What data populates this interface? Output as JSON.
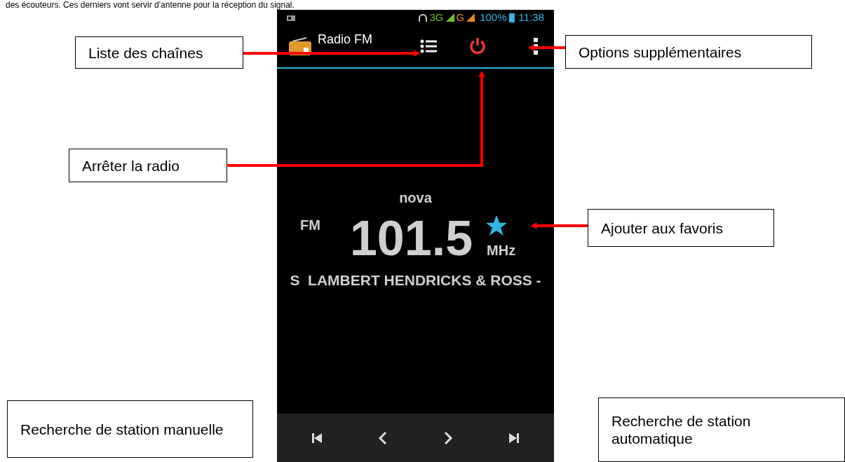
{
  "intro_text": "des écouteurs. Ces derniers vont servir d'antenne pour la réception du signal.",
  "status_bar": {
    "network_1": "3G",
    "network_2": "G",
    "battery": "100%",
    "time": "11:38"
  },
  "action_bar": {
    "title": "Radio FM"
  },
  "station": {
    "name": "nova",
    "band": "FM",
    "frequency": "101.5",
    "unit": "MHz",
    "favorite": true,
    "ticker": "S  LAMBERT HENDRICKS & ROSS -"
  },
  "callouts": [
    {
      "text": "Liste des chaînes"
    },
    {
      "text": "Options supplémentaires"
    },
    {
      "text": "Arrêter la radio"
    },
    {
      "text": "Ajouter aux favoris"
    },
    {
      "text": "Recherche de station manuelle"
    },
    {
      "text": "Recherche de station automatique"
    }
  ]
}
